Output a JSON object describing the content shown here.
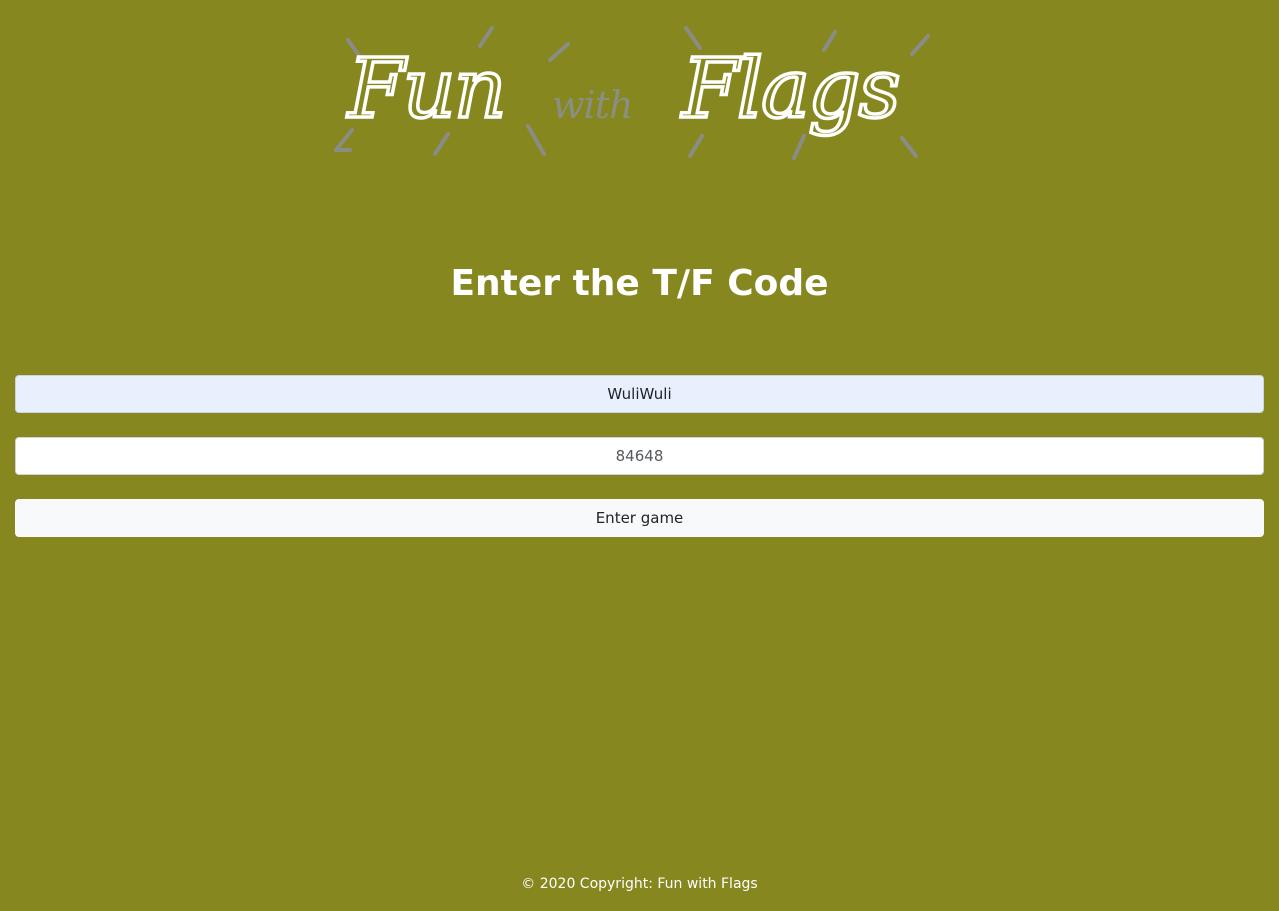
{
  "logo": {
    "word_1": "Fun",
    "word_2": "with",
    "word_3": "Flags",
    "ray_color": "#8a8c86",
    "with_color": "#8a8f84"
  },
  "page": {
    "title": "Enter the T/F Code",
    "background_color": "#86871f"
  },
  "form": {
    "name_value": "WuliWuli",
    "code_value": "84648",
    "submit_label": "Enter game"
  },
  "footer": {
    "text": "© 2020 Copyright: Fun with Flags"
  }
}
